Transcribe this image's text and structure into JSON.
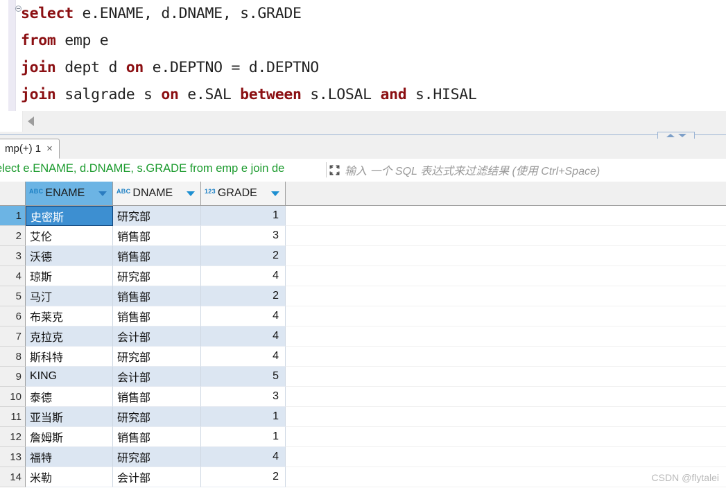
{
  "editor": {
    "fold_marker": "collapse-marker",
    "lines": [
      [
        {
          "t": "select",
          "kw": true
        },
        {
          "t": " e.ENAME, d.DNAME, s.GRADE",
          "kw": false
        }
      ],
      [
        {
          "t": "from",
          "kw": true
        },
        {
          "t": " emp e",
          "kw": false
        }
      ],
      [
        {
          "t": "join",
          "kw": true
        },
        {
          "t": " dept d ",
          "kw": false
        },
        {
          "t": "on",
          "kw": true
        },
        {
          "t": " e.DEPTNO = d.DEPTNO",
          "kw": false
        }
      ],
      [
        {
          "t": "join",
          "kw": true
        },
        {
          "t": " salgrade s ",
          "kw": false
        },
        {
          "t": "on",
          "kw": true
        },
        {
          "t": " e.SAL ",
          "kw": false
        },
        {
          "t": "between",
          "kw": true
        },
        {
          "t": " s.LOSAL ",
          "kw": false
        },
        {
          "t": "and",
          "kw": true
        },
        {
          "t": " s.HISAL",
          "kw": false
        }
      ]
    ],
    "plain_sql": "select e.ENAME, d.DNAME, s.GRADE\nfrom emp e\njoin dept d on e.DEPTNO = d.DEPTNO\njoin salgrade s on e.SAL between s.LOSAL and s.HISAL",
    "keyword_color": "#8b0f12",
    "text_color": "#222222",
    "scroll_left_arrow": "scroll-left-arrow"
  },
  "splitter": {
    "collapse_up": "triangle-up-icon",
    "collapse_down": "triangle-down-icon",
    "line_color": "#9bb4d4"
  },
  "tabs": [
    {
      "label": "mp(+) 1",
      "close": "×",
      "active": true
    }
  ],
  "filter": {
    "query_text": "elect e.ENAME, d.DNAME, s.GRADE from emp e join de",
    "query_color": "#1a9a2c",
    "expand_icon": "expand-icon",
    "placeholder": "输入 一个 SQL 表达式来过滤结果 (使用 Ctrl+Space)"
  },
  "grid": {
    "columns": [
      {
        "label": "ENAME",
        "type_icon": "ABC",
        "selected": true,
        "align": "left"
      },
      {
        "label": "DNAME",
        "type_icon": "ABC",
        "selected": false,
        "align": "left"
      },
      {
        "label": "GRADE",
        "type_icon": "123",
        "selected": false,
        "align": "right"
      }
    ],
    "selected_row": 1,
    "selection_color": "#3d8fd1",
    "header_selected_color": "#6cb4e4",
    "alt_row_color": "#dce6f2",
    "rows": [
      {
        "n": "1",
        "ENAME": "史密斯",
        "DNAME": "研究部",
        "GRADE": "1"
      },
      {
        "n": "2",
        "ENAME": "艾伦",
        "DNAME": "销售部",
        "GRADE": "3"
      },
      {
        "n": "3",
        "ENAME": "沃德",
        "DNAME": "销售部",
        "GRADE": "2"
      },
      {
        "n": "4",
        "ENAME": "琼斯",
        "DNAME": "研究部",
        "GRADE": "4"
      },
      {
        "n": "5",
        "ENAME": "马汀",
        "DNAME": "销售部",
        "GRADE": "2"
      },
      {
        "n": "6",
        "ENAME": "布莱克",
        "DNAME": "销售部",
        "GRADE": "4"
      },
      {
        "n": "7",
        "ENAME": "克拉克",
        "DNAME": "会计部",
        "GRADE": "4"
      },
      {
        "n": "8",
        "ENAME": "斯科特",
        "DNAME": "研究部",
        "GRADE": "4"
      },
      {
        "n": "9",
        "ENAME": "KING",
        "DNAME": "会计部",
        "GRADE": "5"
      },
      {
        "n": "10",
        "ENAME": "泰德",
        "DNAME": "销售部",
        "GRADE": "3"
      },
      {
        "n": "11",
        "ENAME": "亚当斯",
        "DNAME": "研究部",
        "GRADE": "1"
      },
      {
        "n": "12",
        "ENAME": "詹姆斯",
        "DNAME": "销售部",
        "GRADE": "1"
      },
      {
        "n": "13",
        "ENAME": "福特",
        "DNAME": "研究部",
        "GRADE": "4"
      },
      {
        "n": "14",
        "ENAME": "米勒",
        "DNAME": "会计部",
        "GRADE": "2"
      }
    ]
  },
  "watermark": "CSDN @flytalei"
}
